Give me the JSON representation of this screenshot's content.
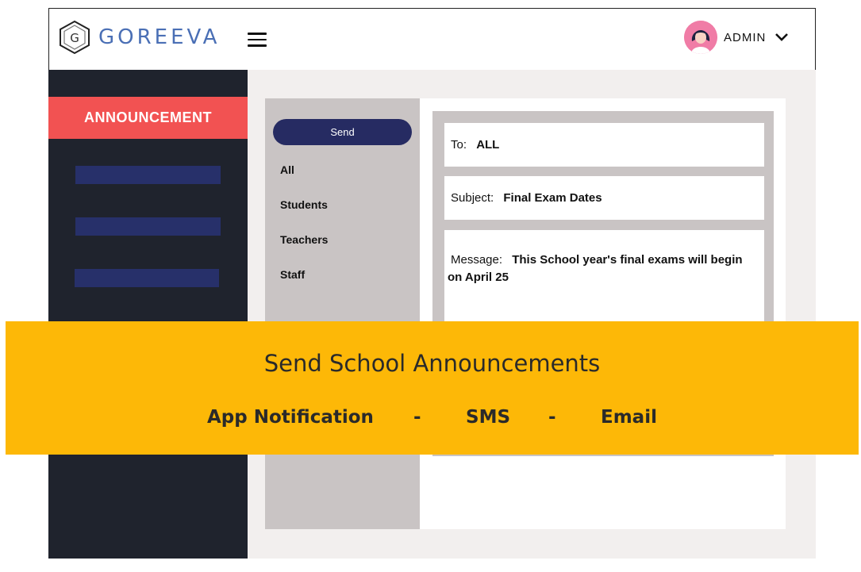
{
  "header": {
    "logo_letter": "G",
    "logo_text": "GOREEVA",
    "user_label": "ADMIN"
  },
  "sidebar": {
    "active_item": "ANNOUNCEMENT"
  },
  "audience": {
    "send_label": "Send",
    "options": [
      "All",
      "Students",
      "Teachers",
      "Staff"
    ]
  },
  "compose": {
    "to_label": "To:",
    "to_value": "ALL",
    "subject_label": "Subject:",
    "subject_value": "Final Exam Dates",
    "message_label": "Message:",
    "message_value": "This School year's final exams will begin on April 25"
  },
  "banner": {
    "title": "Send School Announcements",
    "channels": [
      "App Notification",
      "SMS",
      "Email"
    ],
    "separator": "-"
  },
  "colors": {
    "brand_blue": "#4a6fb5",
    "sidebar_bg": "#1f232d",
    "active_red": "#f25252",
    "button_navy": "#262b62",
    "banner_yellow": "#fdb807"
  },
  "icons": [
    "hexagon-logo-icon",
    "hamburger-menu-icon",
    "chevron-down-icon",
    "user-avatar"
  ]
}
